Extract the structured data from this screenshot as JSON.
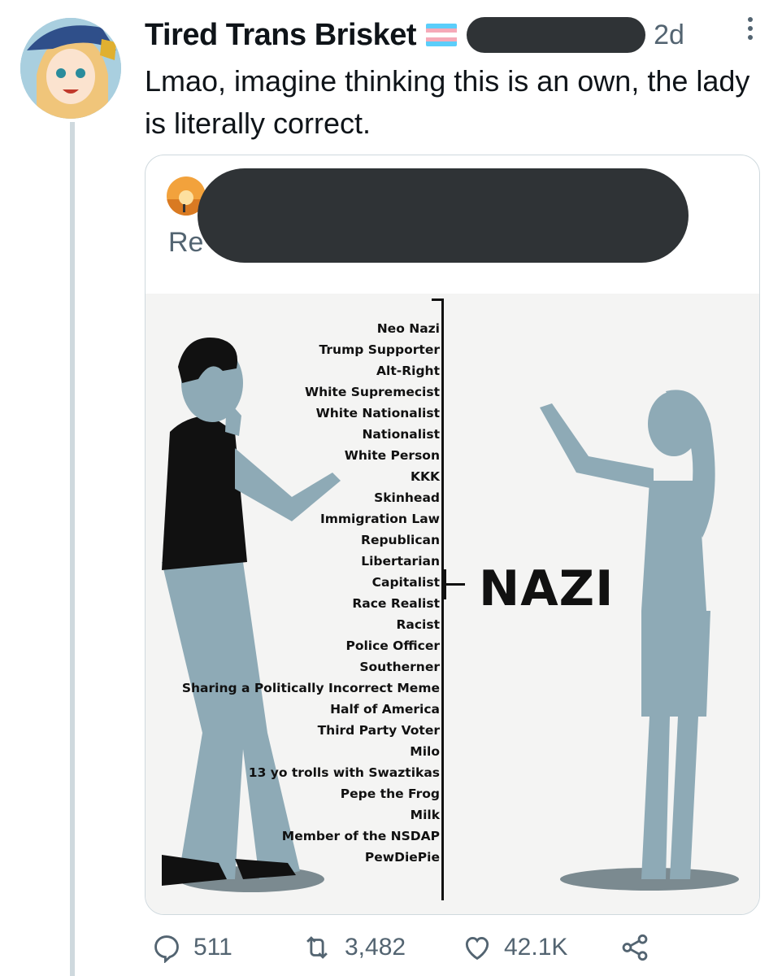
{
  "tweet": {
    "author_name": "Tired Trans Brisket",
    "timestamp": "2d",
    "text": "Lmao, imagine thinking this is an own, the lady is literally correct."
  },
  "quoted_tweet": {
    "reply_prefix": "Re",
    "meme": {
      "labels": [
        "Neo Nazi",
        "Trump Supporter",
        "Alt-Right",
        "White Supremecist",
        "White Nationalist",
        "Nationalist",
        "White Person",
        "KKK",
        "Skinhead",
        "Immigration Law",
        "Republican",
        "Libertarian",
        "Capitalist",
        "Race Realist",
        "Racist",
        "Police Officer",
        "Southerner",
        "Sharing a Politically Incorrect Meme",
        "Half of America",
        "Third Party Voter",
        "Milo",
        "13 yo trolls with Swaztikas",
        "Pepe the Frog",
        "Milk",
        "Member of the NSDAP",
        "PewDiePie"
      ],
      "result_label": "NAZI"
    }
  },
  "actions": {
    "replies": "511",
    "retweets": "3,482",
    "likes": "42.1K"
  },
  "icons": {
    "reply": "reply-icon",
    "retweet": "retweet-icon",
    "like": "heart-icon",
    "share": "share-icon",
    "more": "more-vertical-icon"
  },
  "colors": {
    "text_primary": "#0f1419",
    "text_secondary": "#536471",
    "border": "#cfd9de",
    "redaction": "#2f3336",
    "flag_blue": "#5bcefa",
    "flag_pink": "#f5a9b8",
    "flag_white": "#ffffff"
  }
}
